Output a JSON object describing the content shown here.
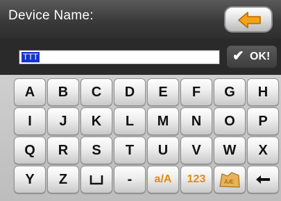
{
  "header": {
    "title": "Device Name:",
    "back_icon": "back-arrow-icon"
  },
  "input": {
    "value": "TTT",
    "ok_label": "OK!",
    "ok_icon": "checkmark-icon"
  },
  "keyboard": {
    "row1": [
      "A",
      "B",
      "C",
      "D",
      "E",
      "F",
      "G",
      "H"
    ],
    "row2": [
      "I",
      "J",
      "K",
      "L",
      "M",
      "N",
      "O",
      "P"
    ],
    "row3": [
      "Q",
      "R",
      "S",
      "T",
      "U",
      "V",
      "W",
      "X"
    ],
    "row4": {
      "y": "Y",
      "z": "Z",
      "space_icon": "space-bar-icon",
      "dash": "-",
      "case_toggle": "a/A",
      "numbers": "123",
      "symbols_icon": "symbols-keyboard-icon",
      "backspace_icon": "backspace-arrow-icon"
    }
  }
}
